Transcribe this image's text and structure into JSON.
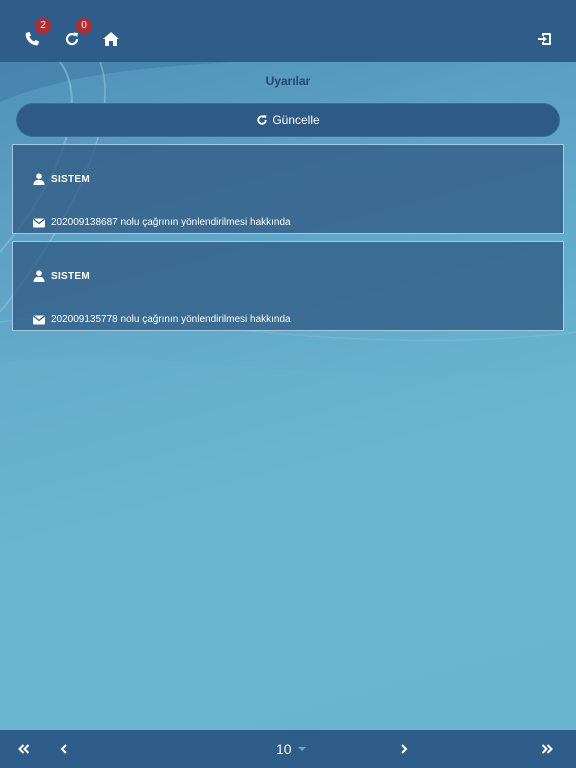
{
  "header": {
    "calls_badge": "2",
    "sync_badge": "0",
    "icons": [
      "phone-icon",
      "refresh-icon",
      "home-icon",
      "logout-icon"
    ]
  },
  "page": {
    "title": "Uyarılar",
    "refresh_label": "Güncelle"
  },
  "alerts": [
    {
      "sender": "SISTEM",
      "message": "202009138687 nolu çağrının yönlendirilmesi hakkında"
    },
    {
      "sender": "SISTEM",
      "message": "202009135778 nolu çağrının yönlendirilmesi hakkında"
    }
  ],
  "pagination": {
    "page_size": "10"
  },
  "colors": {
    "bar": "#2f5d8a",
    "badge": "#b32a2f",
    "title": "#23476e",
    "card": "#315b84"
  }
}
